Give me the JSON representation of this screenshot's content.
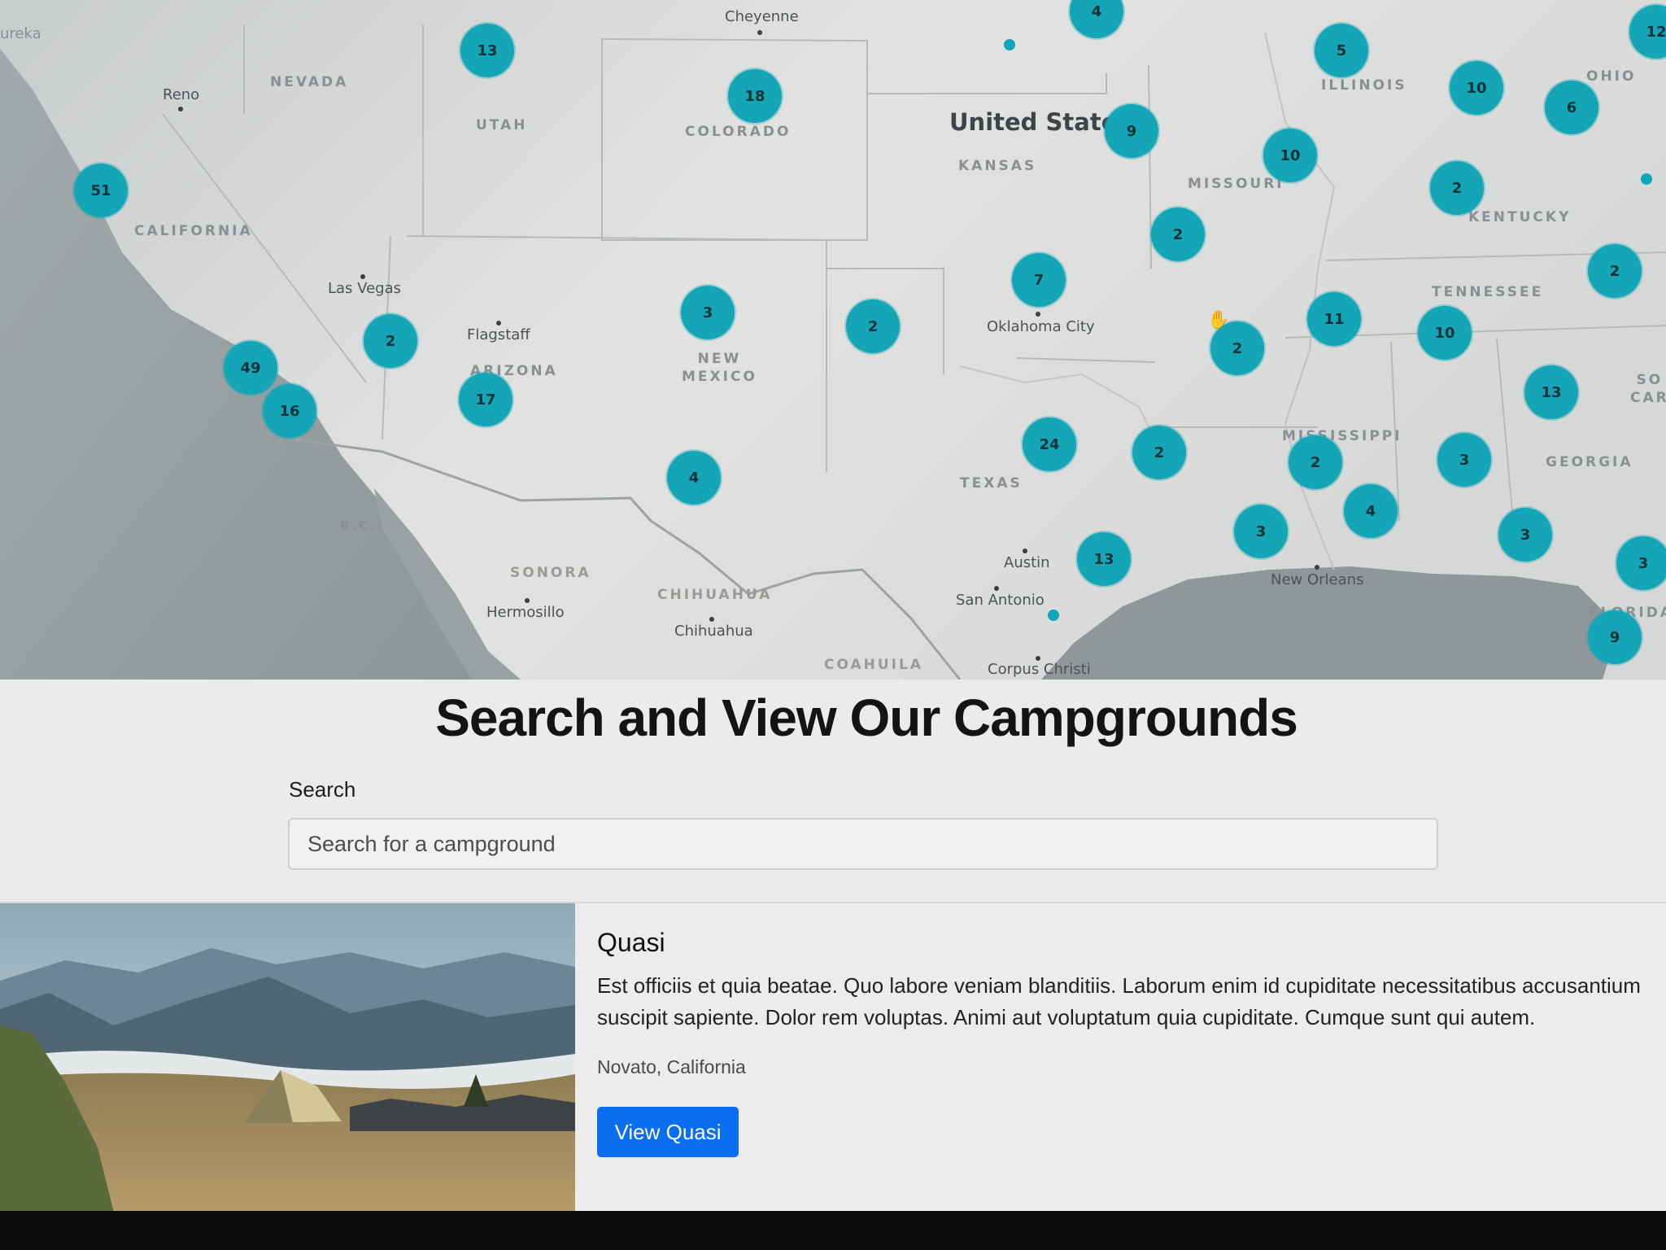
{
  "colors": {
    "cluster": "#14a6b7",
    "button": "#0a6ef0",
    "page_bg": "#ebebeb"
  },
  "map": {
    "country_label": "United States",
    "state_labels": [
      "NEVADA",
      "UTAH",
      "COLORADO",
      "KANSAS",
      "MISSOURI",
      "ILLINOIS",
      "OHIO",
      "KENTUCKY",
      "TENNESSEE",
      "CALIFORNIA",
      "ARIZONA",
      "NEW\nMEXICO",
      "TEXAS",
      "MISSISSIPPI",
      "GEORGIA",
      "SO\nCAR",
      "FLORIDA",
      "B.C."
    ],
    "region_labels": [
      "SONORA",
      "CHIHUAHUA",
      "COAHUILA"
    ],
    "city_labels": [
      "Cheyenne",
      "Reno",
      "Las Vegas",
      "Flagstaff",
      "Oklahoma City",
      "Austin",
      "San Antonio",
      "Corpus Christi",
      "New Orleans",
      "Hermosillo",
      "Chihuahua",
      "ureka"
    ],
    "clusters": [
      "13",
      "4",
      "5",
      "12",
      "18",
      "9",
      "10",
      "6",
      "51",
      "10",
      "2",
      "2",
      "7",
      "2",
      "2",
      "3",
      "2",
      "11",
      "10",
      "49",
      "2",
      "16",
      "17",
      "13",
      "4",
      "24",
      "2",
      "2",
      "3",
      "3",
      "3",
      "4",
      "3",
      "13",
      "9",
      "3"
    ],
    "cursor_icon": "hand-grab-icon"
  },
  "heading": "Search and View Our Campgrounds",
  "search": {
    "label": "Search",
    "placeholder": "Search for a campground"
  },
  "campground": {
    "title": "Quasi",
    "description": "Est officiis et quia beatae. Quo labore veniam blanditiis. Laborum enim id cupiditate necessitatibus accusantium suscipit sapiente. Dolor rem voluptas. Animi aut voluptatum quia cupiditate. Cumque sunt qui autem.",
    "location": "Novato, California",
    "button_label": "View Quasi",
    "image_icon": "mountain-tent-photo"
  }
}
